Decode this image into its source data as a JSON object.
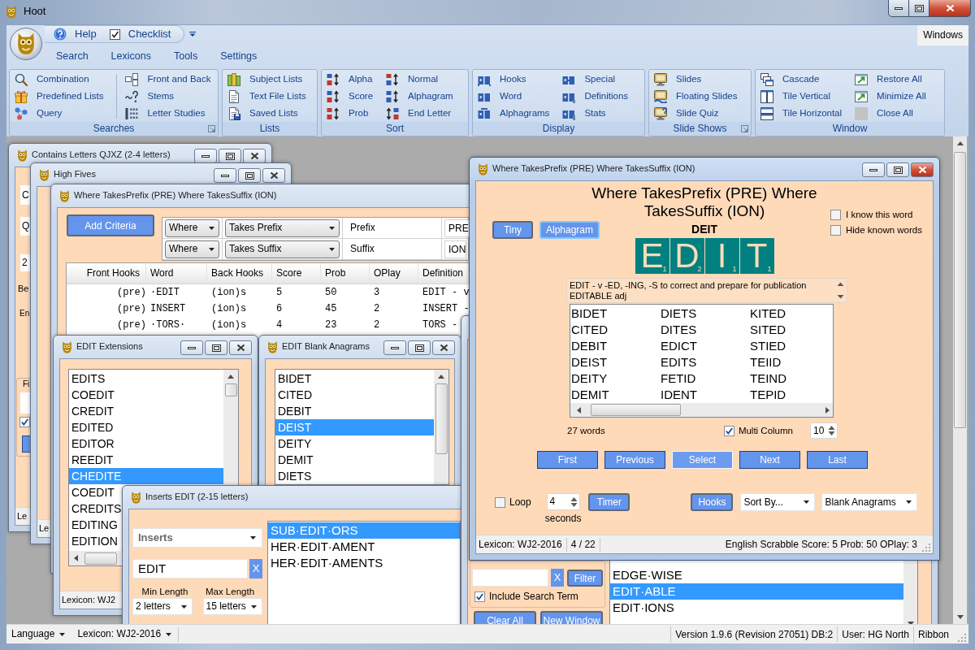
{
  "window": {
    "title": "Hoot"
  },
  "quick_access": [
    {
      "label": "Help"
    },
    {
      "label": "Checklist"
    }
  ],
  "ribbon_tabs": [
    {
      "label": "Search"
    },
    {
      "label": "Lexicons"
    },
    {
      "label": "Tools"
    },
    {
      "label": "Settings"
    }
  ],
  "windows_button": "Windows",
  "ribbon_groups": [
    {
      "label": "Searches",
      "launcher": true,
      "divider": true,
      "columns": [
        [
          "Combination",
          "Predefined Lists",
          "Query"
        ],
        [
          "Front and Back",
          "Stems",
          "Letter Studies"
        ]
      ]
    },
    {
      "label": "Lists",
      "launcher": false,
      "columns": [
        [
          "Subject Lists",
          "Text File Lists",
          "Saved Lists"
        ]
      ]
    },
    {
      "label": "Sort",
      "launcher": false,
      "divider": false,
      "columns": [
        [
          "Alpha",
          "Score",
          "Prob"
        ],
        [
          "Normal",
          "Alphagram",
          "End Letter"
        ]
      ]
    },
    {
      "label": "Display",
      "launcher": false,
      "divider": false,
      "columns": [
        [
          "Hooks",
          "Word",
          "Alphagrams"
        ],
        [
          "Special",
          "Definitions",
          "Stats"
        ]
      ]
    },
    {
      "label": "Slide Shows",
      "launcher": true,
      "columns": [
        [
          "Slides",
          "Floating Slides",
          "Slide Quiz"
        ]
      ]
    },
    {
      "label": "Window",
      "launcher": false,
      "divider": false,
      "columns": [
        [
          "Cascade",
          "Tile Vertical",
          "Tile Horizontal"
        ],
        [
          "Restore All",
          "Minimize All",
          "Close All"
        ]
      ]
    }
  ],
  "mdi_windows": [
    {
      "kind": "form",
      "title": "Contains Letters QJXZ (2-4 letters)",
      "active": false,
      "fields": [
        "C",
        "Q",
        "2"
      ],
      "labels": [
        "Be",
        "En"
      ],
      "group": {
        "label": "Fi",
        "checked": true
      },
      "status": "Le"
    },
    {
      "kind": "empty",
      "title": "High Fives",
      "active": false,
      "status": "Le"
    },
    {
      "kind": "criteria",
      "title": "Where TakesPrefix (PRE) Where TakesSuffix (ION)",
      "active": false,
      "add_button": "Add Criteria",
      "criteria": [
        {
          "where": "Where",
          "condition": "Takes Prefix",
          "parameter": "Prefix",
          "value": "PRE"
        },
        {
          "where": "Where",
          "condition": "Takes Suffix",
          "parameter": "Suffix",
          "value": "ION"
        }
      ],
      "table": {
        "columns": [
          "Front Hooks",
          "Word",
          "Back Hooks",
          "Score",
          "Prob",
          "OPlay",
          "Definition"
        ],
        "rows": [
          [
            "(pre)",
            "·EDIT",
            "(ion)s",
            "5",
            "50",
            "3",
            "EDIT - v"
          ],
          [
            "(pre)",
            "INSERT",
            "(ion)s",
            "6",
            "45",
            "2",
            "INSERT -"
          ],
          [
            "(pre)",
            "·TORS·",
            "(ion)s",
            "4",
            "23",
            "2",
            "TORS -"
          ]
        ]
      }
    },
    {
      "kind": "word_list",
      "title": "EDIT Extensions",
      "active": false,
      "items": [
        {
          "text": "EDITS",
          "selected": false
        },
        {
          "text": "COEDIT",
          "selected": false
        },
        {
          "text": "CREDIT",
          "selected": false
        },
        {
          "text": "EDITED",
          "selected": false
        },
        {
          "text": "EDITOR",
          "selected": false
        },
        {
          "text": "REEDIT",
          "selected": false
        },
        {
          "text": "CHEDITE",
          "selected": true
        },
        {
          "text": "COEDIT",
          "selected": false
        },
        {
          "text": "CREDITS",
          "selected": false
        },
        {
          "text": "EDITING",
          "selected": false
        },
        {
          "text": "EDITION",
          "selected": false
        }
      ],
      "status": "Lexicon: WJ2"
    },
    {
      "kind": "word_list",
      "title": "EDIT Blank Anagrams",
      "active": false,
      "items": [
        {
          "text": "BIDET",
          "selected": false
        },
        {
          "text": "CITED",
          "selected": false
        },
        {
          "text": "DEBIT",
          "selected": false
        },
        {
          "text": "DEIST",
          "selected": true
        },
        {
          "text": "DEITY",
          "selected": false
        },
        {
          "text": "DEMIT",
          "selected": false
        },
        {
          "text": "DIETS",
          "selected": false
        }
      ]
    },
    {
      "kind": "inserts",
      "title": "Inserts EDIT (2-15 letters)",
      "active": false,
      "search_type": "Inserts",
      "search_value": "EDIT",
      "clear_button": "X",
      "min_label": "Min Length",
      "max_label": "Max Length",
      "min_length": "2 letters",
      "max_length": "15 letters",
      "results": [
        {
          "text": "SUB·EDIT·ORS",
          "selected": true
        },
        {
          "text": "HER·EDIT·AMENT",
          "selected": false
        },
        {
          "text": "HER·EDIT·AMENTS",
          "selected": false
        }
      ]
    },
    {
      "kind": "quiz",
      "title": "Where TakesPrefix (PRE) Where TakesSuffix (ION)",
      "active": true,
      "heading": "Where TakesPrefix (PRE) Where TakesSuffix (ION)",
      "view_buttons": [
        {
          "label": "Tiny",
          "focused": false
        },
        {
          "label": "Alphagram",
          "focused": true
        }
      ],
      "options": [
        {
          "label": "I know this word",
          "checked": false
        },
        {
          "label": "Hide known words",
          "checked": false
        }
      ],
      "alphagram": "DEIT",
      "tiles": [
        {
          "letter": "E",
          "score": "1"
        },
        {
          "letter": "D",
          "score": "2"
        },
        {
          "letter": "I",
          "score": "1"
        },
        {
          "letter": "T",
          "score": "1"
        }
      ],
      "definition": "EDIT - v -ED, -ING, -S to correct and prepare for publication\nEDITABLE adj",
      "words": [
        "BIDET",
        "CITED",
        "DEBIT",
        "DEIST",
        "DEITY",
        "DEMIT",
        "DIETS",
        "DITES",
        "EDICT",
        "EDITS",
        "FETID",
        "IDENT",
        "KITED",
        "SITED",
        "STIED",
        "TEIID",
        "TEIND",
        "TEPID"
      ],
      "word_count": "27 words",
      "multi_column": {
        "label": "Multi Column",
        "checked": true
      },
      "column_count": "10",
      "nav_buttons": [
        {
          "label": "First",
          "highlighted": false
        },
        {
          "label": "Previous",
          "highlighted": false
        },
        {
          "label": "Select",
          "highlighted": true
        },
        {
          "label": "Next",
          "highlighted": false
        },
        {
          "label": "Last",
          "highlighted": false
        }
      ],
      "loop": {
        "label": "Loop",
        "checked": false
      },
      "timer_value": "4",
      "timer_unit": "seconds",
      "timer_button": "Timer",
      "hooks_button": "Hooks",
      "sort_by": "Sort By...",
      "mode": "Blank Anagrams",
      "status_left": [
        "Lexicon: WJ2-2016",
        "4 / 22"
      ],
      "status_right": "English Scrabble Score: 5 Prob: 50 OPlay: 3"
    },
    {
      "kind": "filter_list",
      "active": false,
      "clear_button": "X",
      "filter_button": "Filter",
      "include_search_term": {
        "label": "Include Search Term",
        "checked": true
      },
      "buttons": [
        "Clear All",
        "New Window"
      ],
      "items": [
        {
          "text": "EDGE·WISE",
          "selected": false
        },
        {
          "text": "EDIT·ABLE",
          "selected": true
        },
        {
          "text": "EDIT·IONS",
          "selected": false
        }
      ]
    }
  ],
  "status_bar": {
    "menus": [
      {
        "label": "Language"
      },
      {
        "label": "Lexicon: WJ2-2016"
      }
    ],
    "panels": [
      "Version 1.9.6 (Revision 27051) DB:2",
      "User: HG North",
      "Ribbon"
    ]
  }
}
